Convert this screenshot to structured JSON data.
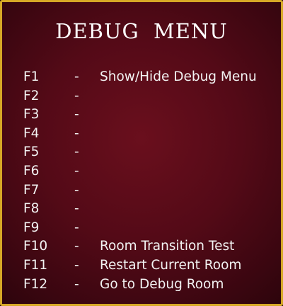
{
  "menu": {
    "title": "Debug  Menu",
    "rows": [
      {
        "key": "F1",
        "sep": "-",
        "desc": "Show/Hide Debug Menu"
      },
      {
        "key": "F2",
        "sep": "-",
        "desc": ""
      },
      {
        "key": "F3",
        "sep": "-",
        "desc": ""
      },
      {
        "key": "F4",
        "sep": "-",
        "desc": ""
      },
      {
        "key": "F5",
        "sep": "-",
        "desc": ""
      },
      {
        "key": "F6",
        "sep": "-",
        "desc": ""
      },
      {
        "key": "F7",
        "sep": "-",
        "desc": ""
      },
      {
        "key": "F8",
        "sep": "-",
        "desc": ""
      },
      {
        "key": "F9",
        "sep": "-",
        "desc": ""
      },
      {
        "key": "F10",
        "sep": "-",
        "desc": "Room Transition Test"
      },
      {
        "key": "F11",
        "sep": "-",
        "desc": "Restart Current Room"
      },
      {
        "key": "F12",
        "sep": "-",
        "desc": "Go to Debug Room"
      }
    ]
  },
  "colors": {
    "border": "#d6a826",
    "background": "#540a17",
    "text": "#f2f2f2"
  }
}
